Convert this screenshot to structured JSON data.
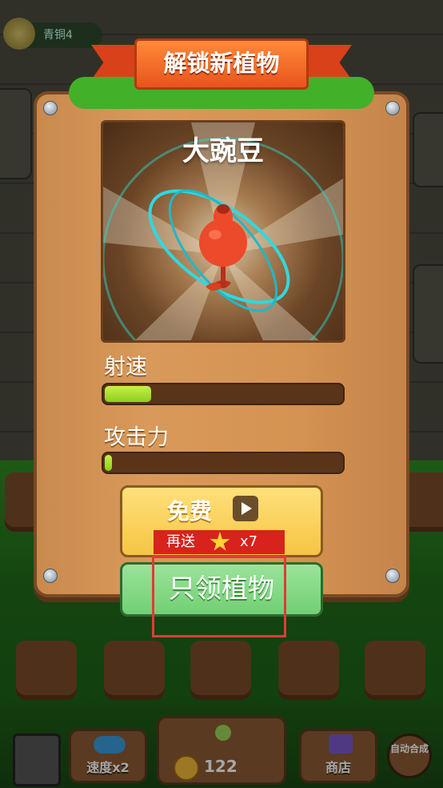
{
  "hud": {
    "rank_label": "青铜4"
  },
  "dialog": {
    "banner_title": "解锁新植物",
    "plant_name": "大豌豆",
    "stats": [
      {
        "label": "射速",
        "level": 0.2
      },
      {
        "label": "攻击力",
        "level": 0.03
      }
    ],
    "free_button": {
      "label": "免费"
    },
    "bonus": {
      "prefix": "再送",
      "multiplier": "x7"
    },
    "claim_button": {
      "label": "只领植物"
    }
  },
  "bottom_bar": {
    "speed_label": "速度x2",
    "coins": "122",
    "shop_label": "商店",
    "auto_label": "自动合成"
  },
  "colors": {
    "accent_orange": "#e8541c",
    "bar_fill": "#8ccf1c",
    "claim_green": "#72cf74",
    "highlight_red": "#e23a3a"
  }
}
